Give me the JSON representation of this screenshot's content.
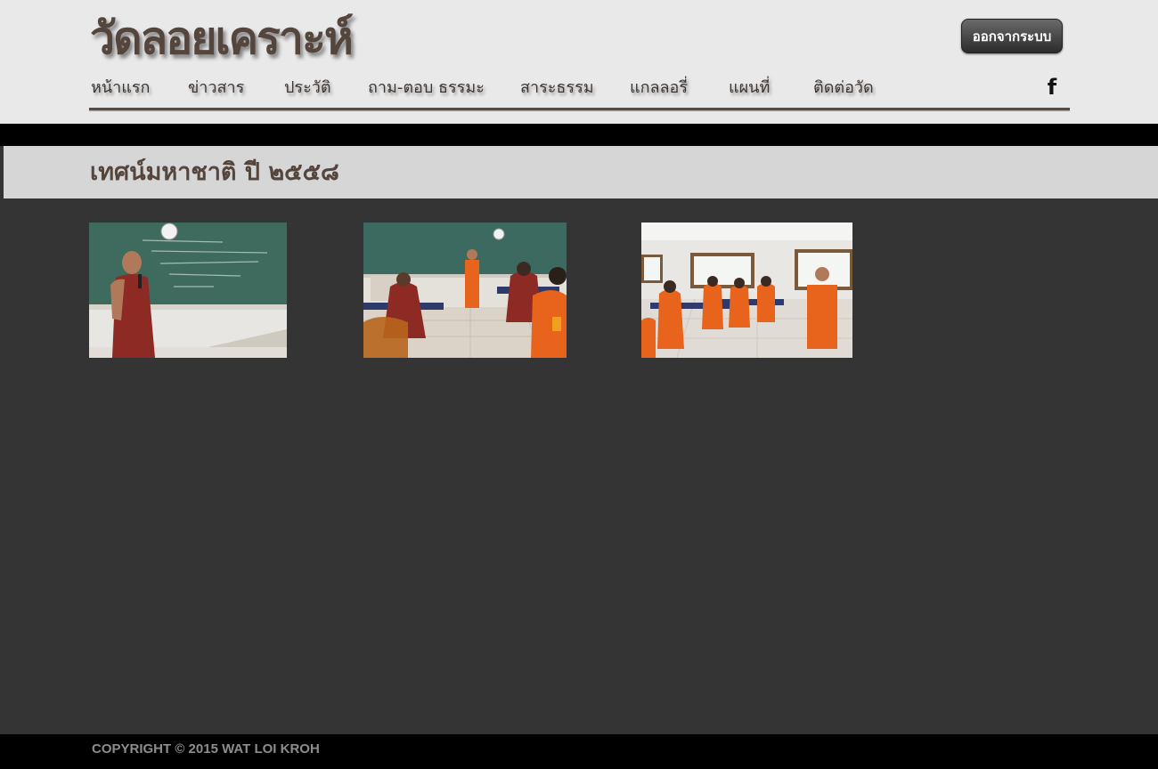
{
  "header": {
    "site_title": "วัดลอยเคราะห์",
    "logout_label": "ออกจากระบบ"
  },
  "nav": {
    "items": [
      {
        "label": "หน้าแรก"
      },
      {
        "label": "ข่าวสาร"
      },
      {
        "label": "ประวัติ"
      },
      {
        "label": "ถาม-ตอบ ธรรมะ"
      },
      {
        "label": "สาระธรรม"
      },
      {
        "label": "แกลลอรี่"
      },
      {
        "label": "แผนที่"
      },
      {
        "label": "ติดต่อวัด"
      }
    ],
    "facebook_glyph": "f"
  },
  "page": {
    "title": "เทศน์มหาชาติ ปี ๒๕๕๘"
  },
  "gallery": {
    "photos": [
      {
        "icon": "photo-monk-teaching-blackboard"
      },
      {
        "icon": "photo-classroom-monks-seated"
      },
      {
        "icon": "photo-classroom-monk-speaking"
      }
    ]
  },
  "footer": {
    "copyright": "COPYRIGHT © 2015 WAT LOI KROH"
  },
  "colors": {
    "header_bg": "#e9e9e9",
    "brand_brown": "#54453d",
    "page_bg": "#343434",
    "title_bar_bg": "#d6d6d6",
    "footer_bg": "#000000",
    "footer_text": "#8d8d8d"
  }
}
